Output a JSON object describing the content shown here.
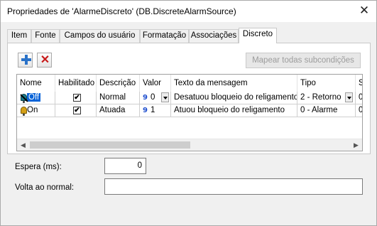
{
  "window": {
    "title": "Propriedades de 'AlarmeDiscreto' (DB.DiscreteAlarmSource)",
    "close_glyph": "✕"
  },
  "tabs": [
    "Item",
    "Fonte",
    "Campos do usuário",
    "Formatação",
    "Associações",
    "Discreto"
  ],
  "active_tab": "Discreto",
  "toolbar": {
    "add_icon": "plus-icon",
    "delete_icon": "close-x-icon",
    "delete_glyph": "✕",
    "map_button": "Mapear todas subcondições"
  },
  "grid": {
    "columns": [
      "Nome",
      "Habilitado",
      "Descrição",
      "Valor",
      "Texto da mensagem",
      "Tipo",
      "S"
    ],
    "rows": [
      {
        "name": "Off",
        "enabled": "✔",
        "description": "Normal",
        "value_glyph": "9",
        "value": "0",
        "message": "Desatuou bloqueio do religamento",
        "type": "2 - Retorno",
        "s": "0"
      },
      {
        "name": "On",
        "enabled": "✔",
        "description": "Atuada",
        "value_glyph": "9",
        "value": "1",
        "message": "Atuou bloqueio do religamento",
        "type": "0 - Alarme",
        "s": "0"
      }
    ],
    "scroll_left": "◀",
    "scroll_right": "▶"
  },
  "fields": {
    "delay_label": "Espera (ms):",
    "delay_value": "0",
    "return_label": "Volta ao normal:",
    "return_value": ""
  },
  "colors": {
    "selection": "#0a64d8",
    "add_icon": "#2a72c8",
    "delete_icon": "#c71a1a",
    "value_icon": "#1f4fcf"
  }
}
